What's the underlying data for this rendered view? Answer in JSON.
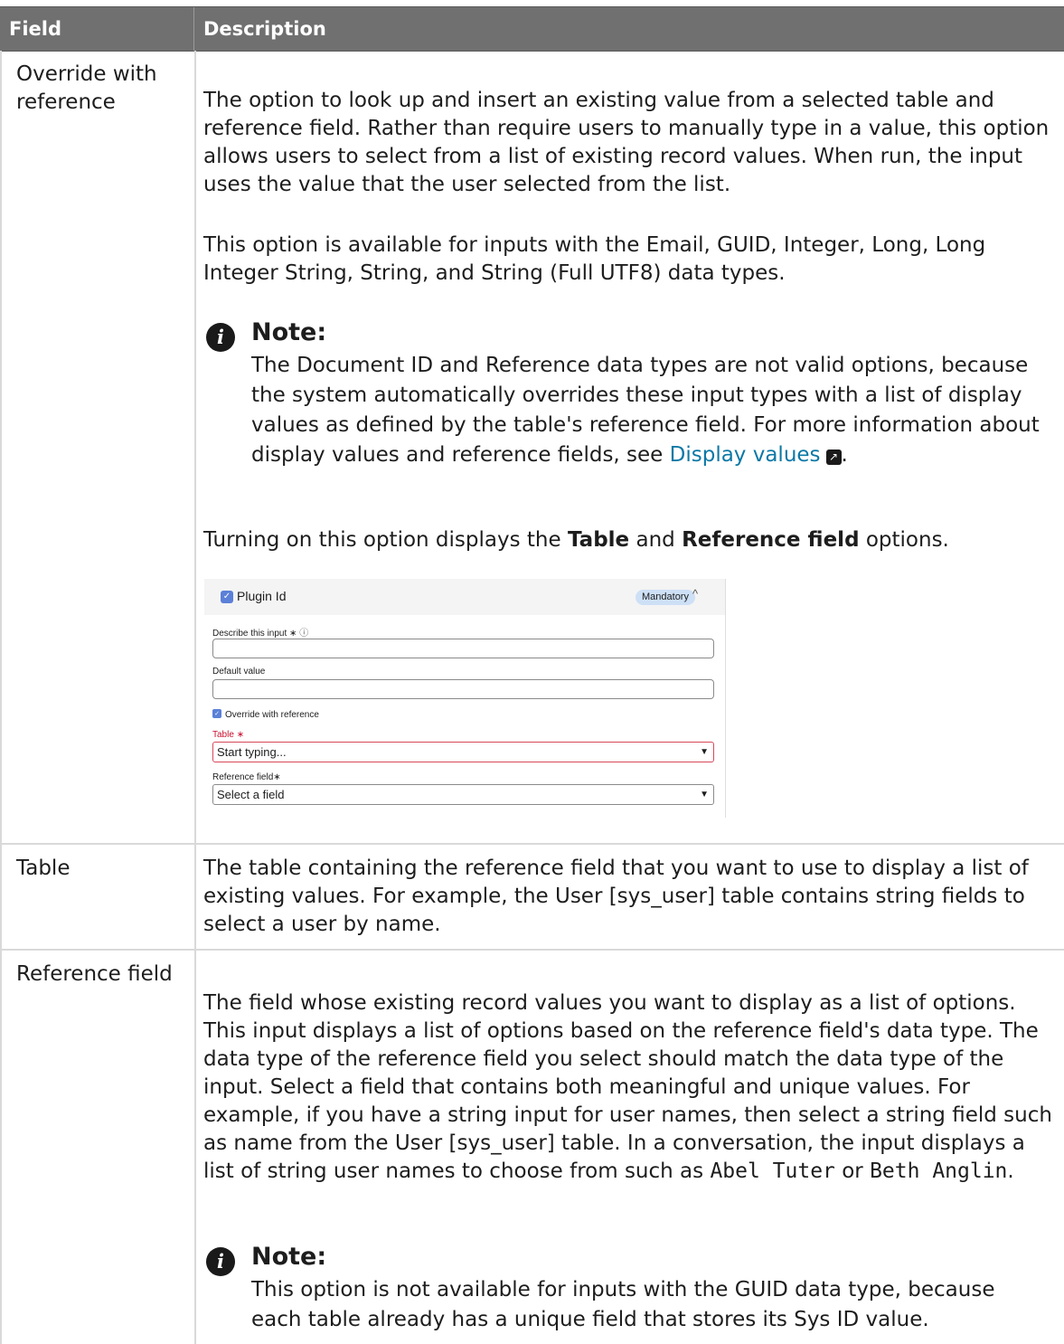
{
  "table": {
    "headers": {
      "field": "Field",
      "description": "Description"
    },
    "rows": [
      {
        "field": "Override with reference",
        "paragraphs": [
          "The option to look up and insert an existing value from a selected table and reference field. Rather than require users to manually type in a value, this option allows users to select from a list of existing record values. When run, the input uses the value that the user selected from the list.",
          "This option is available for inputs with the Email, GUID, Integer, Long, Long Integer String, String, and String (Full UTF8) data types."
        ],
        "note": {
          "title": "Note:",
          "text": "The Document ID and Reference data types are not valid options, because the system automatically overrides these input types with a list of display values as defined by the table's reference field. For more information about display values and reference fields, see",
          "link": "Display values",
          "after_link": "."
        },
        "toggle_sentence": {
          "before": "Turning on this option displays the",
          "bold1": "Table",
          "middle": "and",
          "bold2": "Reference field",
          "after": "options."
        },
        "screenshot": {
          "header_title": "Plugin Id",
          "badge": "Mandatory",
          "describe_label": "Describe this input",
          "default_label": "Default value",
          "override_label": "Override with reference",
          "table_label": "Table",
          "table_placeholder": "Start typing...",
          "reference_label": "Reference field",
          "reference_placeholder": "Select a field",
          "required_mark": "∗"
        }
      },
      {
        "field": "Table",
        "paragraphs": [
          "The table containing the reference field that you want to use to display a list of existing values. For example, the User [sys_user] table contains string fields to select a user by name."
        ]
      },
      {
        "field": "Reference field",
        "paragraphs": [
          "The field whose existing record values you want to display as a list of options. This input displays a list of options based on the reference field's data type. The data type of the reference field you select should match the data type of the input. Select a field that contains both meaningful and unique values. For example, if you have a string input for user names, then select a string field such as name from the User [sys_user] table. In a conversation, the input displays a list of string user names to choose from such as"
        ],
        "example1": "Abel Tuter",
        "or_word": "or",
        "example2": "Beth Anglin",
        "end_punct": ".",
        "note": {
          "title": "Note:",
          "text": "This option is not available for inputs with the GUID data type, because each table already has a unique field that stores its Sys ID value."
        }
      }
    ]
  },
  "icons": {
    "note": "info-icon",
    "external_link": "external-link-icon",
    "dropdown": "caret-down-icon",
    "collapse": "chevron-up-icon"
  },
  "colors": {
    "header_bg": "#707070",
    "link": "#0b78a6",
    "badge_bg": "#cde0f6",
    "required_red": "#c8102e"
  }
}
